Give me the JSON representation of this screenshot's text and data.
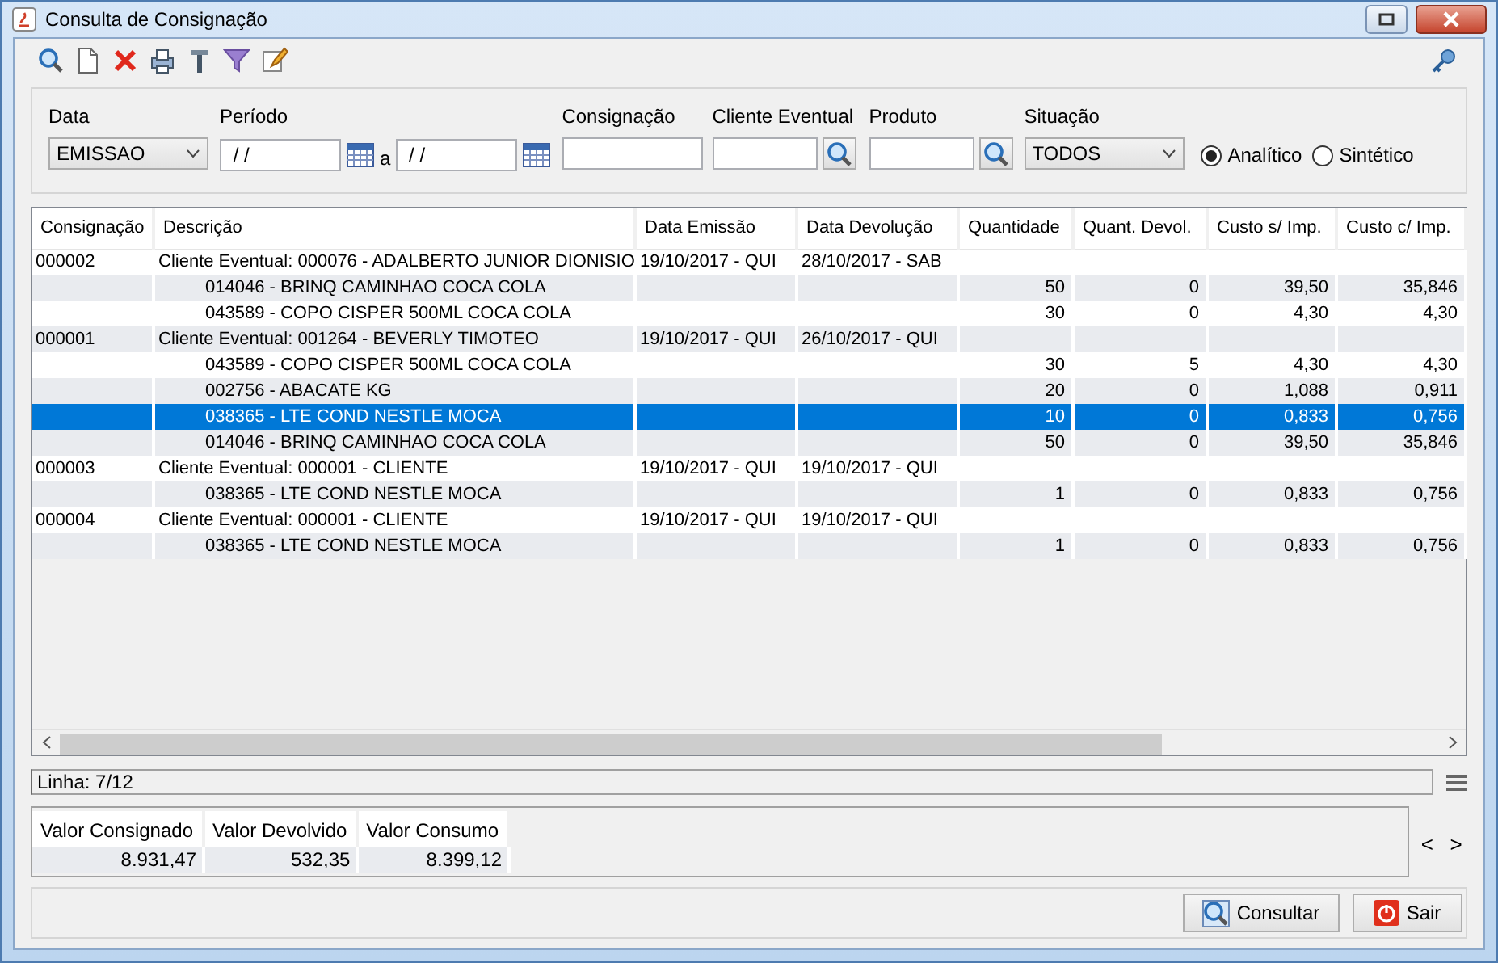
{
  "window": {
    "title": "Consulta de Consignação"
  },
  "filters": {
    "data": {
      "label": "Data",
      "value": "EMISSAO"
    },
    "periodo": {
      "label": "Período",
      "from": " / /",
      "separator": "a",
      "to": " / /"
    },
    "consignacao": {
      "label": "Consignação"
    },
    "cliente": {
      "label": "Cliente Eventual"
    },
    "produto": {
      "label": "Produto"
    },
    "situacao": {
      "label": "Situação",
      "value": "TODOS"
    },
    "modes": [
      {
        "label": "Analítico",
        "selected": true
      },
      {
        "label": "Sintético",
        "selected": false
      }
    ]
  },
  "table": {
    "columns": [
      "Consignação",
      "Descrição",
      "Data Emissão",
      "Data Devolução",
      "Quantidade",
      "Quant. Devol.",
      "Custo s/ Imp.",
      "Custo c/ Imp."
    ],
    "rows": [
      {
        "kind": "group",
        "selected": false,
        "cells": [
          "000002",
          "Cliente Eventual: 000076 - ADALBERTO JUNIOR DIONISIO",
          "19/10/2017 - QUI",
          "28/10/2017 - SAB",
          "",
          "",
          "",
          ""
        ]
      },
      {
        "kind": "item",
        "selected": false,
        "cells": [
          "",
          "014046 - BRINQ CAMINHAO COCA COLA",
          "",
          "",
          "50",
          "0",
          "39,50",
          "35,846"
        ]
      },
      {
        "kind": "item",
        "selected": false,
        "cells": [
          "",
          "043589 - COPO CISPER 500ML COCA COLA",
          "",
          "",
          "30",
          "0",
          "4,30",
          "4,30"
        ]
      },
      {
        "kind": "group",
        "selected": false,
        "cells": [
          "000001",
          "Cliente Eventual: 001264 - BEVERLY TIMOTEO",
          "19/10/2017 - QUI",
          "26/10/2017 - QUI",
          "",
          "",
          "",
          ""
        ]
      },
      {
        "kind": "item",
        "selected": false,
        "cells": [
          "",
          "043589 - COPO CISPER 500ML COCA COLA",
          "",
          "",
          "30",
          "5",
          "4,30",
          "4,30"
        ]
      },
      {
        "kind": "item",
        "selected": false,
        "cells": [
          "",
          "002756 - ABACATE KG",
          "",
          "",
          "20",
          "0",
          "1,088",
          "0,911"
        ]
      },
      {
        "kind": "item",
        "selected": true,
        "cells": [
          "",
          "038365 - LTE COND NESTLE MOCA",
          "",
          "",
          "10",
          "0",
          "0,833",
          "0,756"
        ]
      },
      {
        "kind": "item",
        "selected": false,
        "cells": [
          "",
          "014046 - BRINQ CAMINHAO COCA COLA",
          "",
          "",
          "50",
          "0",
          "39,50",
          "35,846"
        ]
      },
      {
        "kind": "group",
        "selected": false,
        "cells": [
          "000003",
          "Cliente Eventual: 000001 - CLIENTE",
          "19/10/2017 - QUI",
          "19/10/2017 - QUI",
          "",
          "",
          "",
          ""
        ]
      },
      {
        "kind": "item",
        "selected": false,
        "cells": [
          "",
          "038365 - LTE COND NESTLE MOCA",
          "",
          "",
          "1",
          "0",
          "0,833",
          "0,756"
        ]
      },
      {
        "kind": "group",
        "selected": false,
        "cells": [
          "000004",
          "Cliente Eventual: 000001 - CLIENTE",
          "19/10/2017 - QUI",
          "19/10/2017 - QUI",
          "",
          "",
          "",
          ""
        ]
      },
      {
        "kind": "item",
        "selected": false,
        "cells": [
          "",
          "038365 - LTE COND NESTLE MOCA",
          "",
          "",
          "1",
          "0",
          "0,833",
          "0,756"
        ]
      }
    ]
  },
  "status": "Linha: 7/12",
  "totals": [
    {
      "label": "Valor Consignado",
      "value": "8.931,47"
    },
    {
      "label": "Valor Devolvido",
      "value": "532,35"
    },
    {
      "label": "Valor Consumo",
      "value": "8.399,12"
    }
  ],
  "totals_nav": [
    "<",
    ">"
  ],
  "buttons": [
    {
      "kind": "search",
      "label": "Consultar"
    },
    {
      "kind": "exit",
      "label": "Sair"
    }
  ]
}
